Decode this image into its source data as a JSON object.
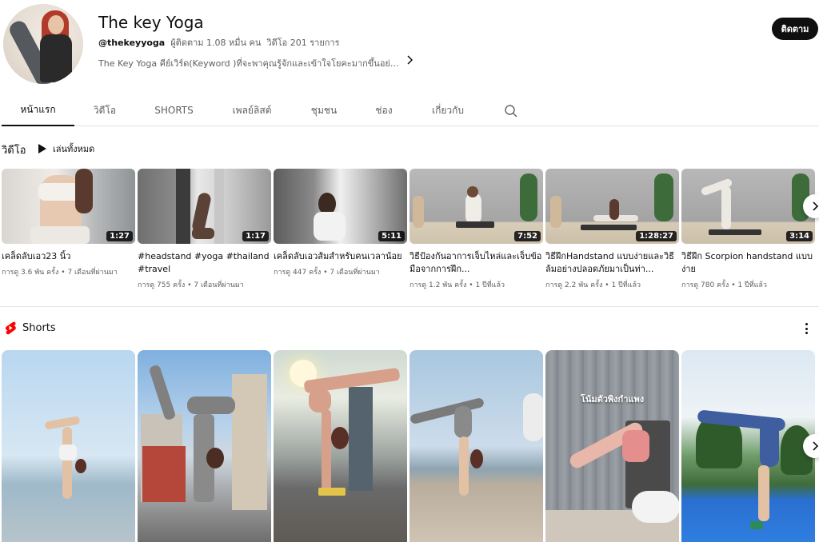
{
  "channel": {
    "name": "The key Yoga",
    "handle": "@thekeyyoga",
    "subscribers": "ผู้ติดตาม 1.08 หมื่น คน",
    "video_count": "วิดีโอ 201 รายการ",
    "description": "The Key Yoga คีย์เวิร์ด(Keyword )ที่จะพาคุณรู้จักและเข้าใจโยคะมากขึ้นอย่างปล...",
    "more_icon": "chevron-right-icon",
    "subscribe_label": "ติดตาม"
  },
  "tabs": [
    {
      "label": "หน้าแรก",
      "active": true
    },
    {
      "label": "วิดีโอ",
      "active": false
    },
    {
      "label": "SHORTS",
      "active": false
    },
    {
      "label": "เพลย์ลิสต์",
      "active": false
    },
    {
      "label": "ชุมชน",
      "active": false
    },
    {
      "label": "ช่อง",
      "active": false
    },
    {
      "label": "เกี่ยวกับ",
      "active": false
    }
  ],
  "videos_section": {
    "title": "วิดีโอ",
    "play_all": "เล่นทั้งหมด",
    "items": [
      {
        "title": "เคล็ดลับเอว23 นิ้ว",
        "duration": "1:27",
        "views": "การดู 3.6 พัน ครั้ง",
        "age": "7 เดือนที่ผ่านมา"
      },
      {
        "title": "#headstand #yoga #thailand #travel",
        "duration": "1:17",
        "views": "การดู 755 ครั้ง",
        "age": "7 เดือนที่ผ่านมา"
      },
      {
        "title": "เคล็ดลับเอวส้มสำหรับคนเวลาน้อย",
        "duration": "5:11",
        "views": "การดู 447 ครั้ง",
        "age": "7 เดือนที่ผ่านมา"
      },
      {
        "title": "วิธีป้องกันอาการเจ็บไหล่และเจ็บข้อมือจากการฝึก...",
        "duration": "7:52",
        "views": "การดู 1.2 พัน ครั้ง",
        "age": "1 ปีที่แล้ว"
      },
      {
        "title": "วิธีฝึกHandstand แบบง่ายและวิธีล้มอย่างปลอดภัยมาเป็นท่า...",
        "duration": "1:28:27",
        "views": "การดู 2.2 พัน ครั้ง",
        "age": "1 ปีที่แล้ว"
      },
      {
        "title": "วิธีฝึก Scorpion handstand แบบง่าย",
        "duration": "3:14",
        "views": "การดู 780 ครั้ง",
        "age": "1 ปีที่แล้ว"
      }
    ]
  },
  "shorts_section": {
    "title": "Shorts",
    "overlay_text": "โน้มตัวพิงกำแพง"
  },
  "colors": {
    "accent": "#ff0000",
    "text": "#0f0f0f",
    "secondary_text": "#606060"
  }
}
